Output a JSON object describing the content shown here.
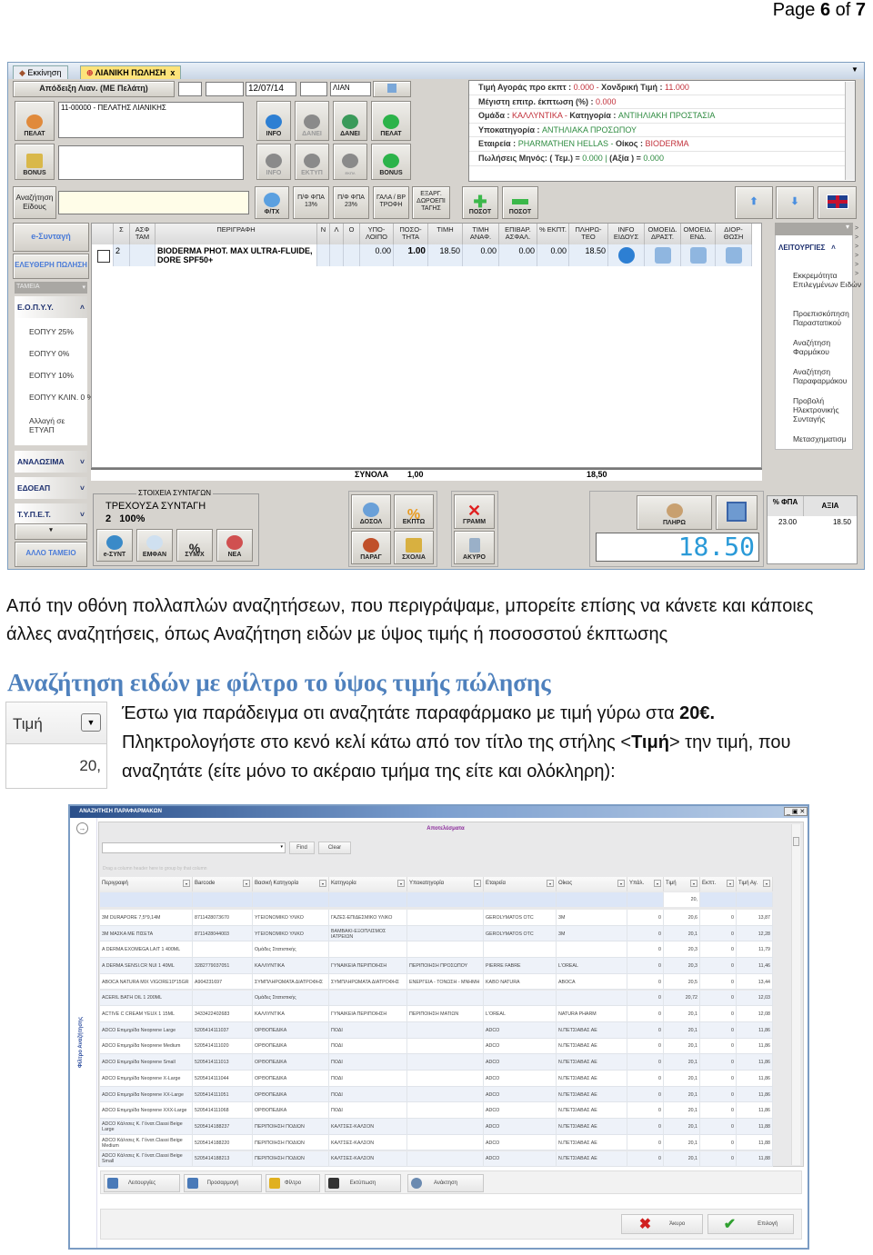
{
  "page_number": {
    "prefix": "Page ",
    "current": "6",
    "sep": " of ",
    "total": "7"
  },
  "pos_window": {
    "tabs": [
      {
        "label": "Εκκίνηση"
      },
      {
        "label": "ΛΙΑΝΙΚΗ ΠΩΛΗΣΗ",
        "close": "x"
      }
    ],
    "doc_type_button": "Απόδειξη Λιαν. (ΜΕ Πελάτη)",
    "date": "12/07/14",
    "series": "ΛΙΑΝ",
    "customer": "11-00000 - ΠΕΛΑΤΗΣ ΛΙΑΝΙΚΗΣ",
    "row1_buttons": [
      "ΠΕΛΑΤ",
      "INFO",
      "ΔΑΝΕΙ",
      "ΔΑΝΕΙ",
      "ΠΕΛΑΤ"
    ],
    "row2_buttons": [
      "BONUS",
      "INFO",
      "ΕΚΤΥΠ",
      "ΕΚΠΛ",
      "BONUS"
    ],
    "search_button": "Αναζήτηση Είδους",
    "row3_buttons": [
      "Φ/ΤΧ",
      "Π/Φ ΦΠΑ 13%",
      "Π/Φ ΦΠΑ 23%",
      "ΓΑΛΑ / ΒΡ ΤΡΟΦΗ",
      "ΕΞΑΡΓ. ΔΩΡΟΕΠΙ ΤΑΓΗΣ",
      "ΠΟΣΟΤ",
      "ΠΟΣΟΤ"
    ],
    "info": {
      "l1a": "Τιμή Αγοράς προ εκπτ : ",
      "v1a": "0.000 - ",
      "l1b": "Χονδρική Τιμή : ",
      "v1b": "11.000",
      "l2": "Μέγιστη επιτρ. έκπτωση (%) : ",
      "v2": "0.000",
      "l3a": "Ομάδα : ",
      "v3a": "ΚΑΛΛΥΝΤΙΚΑ - ",
      "l3b": "Κατηγορία : ",
      "v3b": "ΑΝΤΙΗΛΙΑΚΗ ΠΡΟΣΤΑΣΙΑ",
      "l4": "Υποκατηγορία : ",
      "v4": "ΑΝΤΗΛΙΑΚΑ ΠΡΟΣΩΠΟΥ",
      "l5a": "Εταιρεία : ",
      "v5a": "PHARMATHEN HELLAS - ",
      "l5b": "Οίκος : ",
      "v5b": "BIODERMA",
      "l6a": "Πωλήσεις Μηνός: ( Τεμ.) = ",
      "v6a": "0.000 | ",
      "l6b": "(Αξία ) = ",
      "v6b": "0.000"
    },
    "grid_headers": [
      "",
      "Σ",
      "ΑΣΦ ΤΑΜ",
      "ΠΕΡΙΓΡΑΦΗ",
      "Ν",
      "Λ",
      "Ο",
      "ΥΠΟ-ΛΟΙΠΟ",
      "ΠΟΣΟ-ΤΗΤΑ",
      "ΤΙΜΗ",
      "ΤΙΜΗ ΑΝΑΦ.",
      "ΕΠΙΒΑΡ. ΑΣΦΑΛ.",
      "% ΕΚΠΤ.",
      "ΠΛΗΡΩ-ΤΕΟ",
      "INFO ΕΙΔΟΥΣ",
      "ΟΜΟΕΙΔ. ΔΡΑΣΤ.",
      "ΟΜΟΕΙΔ. ΕΝΔ.",
      "ΔΙΟΡ-ΘΩΣΗ"
    ],
    "grid_row": {
      "s": "2",
      "desc": "BIODERMA PHOT. MAX ULTRA-FLUIDE, DORE SPF50+",
      "remaining": "0.00",
      "qty": "1.00",
      "price": "18.50",
      "ref_price": "0.00",
      "surcharge": "0.00",
      "discount": "0.00",
      "payable": "18.50"
    },
    "totals": {
      "label": "ΣΥΝΟΛΑ",
      "qty": "1,00",
      "amount": "18,50"
    },
    "sidebar": {
      "esyntagi": "e-Συνταγή",
      "free_sale": "ΕΛΕΥΘΕΡΗ ΠΩΛΗΣΗ",
      "funds": "ΤΑΜΕΙΑ",
      "eopyy": "Ε.Ο.Π.Υ.Υ.",
      "eopyy_items": [
        "ΕΟΠΥΥ 25%",
        "ΕΟΠΥΥ  0%",
        "ΕΟΠΥΥ  10%",
        "ΕΟΠΥΥ ΚΛΙΝ. 0 %",
        "Αλλαγή σε ΕΤΥΑΠ"
      ],
      "groups": [
        "ΑΝΑΛΩΣΙΜΑ",
        "ΕΔΟΕΑΠ",
        "Τ.Υ.Π.Ε.Τ."
      ],
      "other_fund": "ΑΛΛΟ ΤΑΜΕΙΟ"
    },
    "functions": {
      "title": "ΛΕΙΤΟΥΡΓΙΕΣ",
      "items": [
        "Εκκρεμότητα Επιλεγμένων Ειδών",
        "Προεπισκόπηση Παραστατικού",
        "Αναζήτηση Φαρμάκου",
        "Αναζήτηση Παραφαρμάκου",
        "Προβολή Ηλεκτρονικής Συνταγής",
        "Μετασχηματισμ"
      ]
    },
    "prescription": {
      "legend": "ΣΤΟΙΧΕΙΑ ΣΥΝΤΑΓΩΝ",
      "current": "ΤΡΕΧΟΥΣΑ ΣΥΝΤΑΓΗ",
      "value": "2   100%",
      "buttons": [
        "e-ΣΥΝΤ",
        "ΕΜΦΑΝ",
        "ΣΥΜ/Χ",
        "ΝΕΑ"
      ]
    },
    "action_buttons": [
      "ΔΟΣΟΛ",
      "ΕΚΠΤΩ",
      "ΠΑΡΑΓ",
      "ΣΧΟΛΙΑ",
      "ΓΡΑΜΜ",
      "ΑΚΥΡΟ"
    ],
    "pay_button": "ΠΛΗΡΩ",
    "total_display": "18.50",
    "vat": {
      "h1": "% ΦΠΑ",
      "h2": "ΑΞΙΑ",
      "rate": "23.00",
      "value": "18.50"
    }
  },
  "intro_text": [
    "Από την οθόνη πολλαπλών αναζητήσεων, που περιγράψαμε, μπορείτε επίσης να κάνετε και κάποιες",
    "άλλες αναζητήσεις, όπως Αναζήτηση ειδών με ύψος τιμής ή ποσοσστού έκπτωσης"
  ],
  "section_title": "Αναζήτηση ειδών με φίλτρο το ύψος τιμής πώλησης",
  "thumb": {
    "header": "Τιμή",
    "value": "20,"
  },
  "body": {
    "l1": "Έστω για παράδειγμα οτι αναζητάτε παραφάρμακο με τιμή γύρω στα ",
    "l1b": "20€.",
    "l2a": "Πληκτρολογήστε στο κενό κελί κάτω από τον τίτλο της στήλης <",
    "l2b": "Τιμή",
    "l2c": "> την τιμή, που",
    "l3": "αναζητάτε (είτε μόνο το ακέραιο τμήμα της είτε και ολόκληρη):"
  },
  "search_window": {
    "title": "ΑΝΑΖΗΤΗΣΗ ΠΑΡΑΦΑΡΜΑΚΩΝ",
    "results": "Αποτελέσματα",
    "find": "Find",
    "clear": "Clear",
    "group_hint": "Drag a column header here to group by that column",
    "side_label": "Φίλτρο Αναζήτησης",
    "columns": [
      "Περιγραφή",
      "Barcode",
      "Βασική Κατηγορία",
      "Κατηγορία",
      "Υποκατηγορία",
      "Εταιρεία",
      "Οίκος",
      "Υπάλ.",
      "Τιμή",
      "Εκπτ.",
      "Τιμή Αγ."
    ],
    "price_filter": "20,",
    "rows": [
      [
        "3M DURAPORE 7,5*9,14M",
        "8711428073670",
        "ΥΓΕΙΟΝΟΜΙΚΟ ΥΛΙΚΟ",
        "ΓΑΖΕΣ-ΕΠΙΔΕΣΜΙΚΟ ΥΛΙΚΟ",
        "",
        "GEROLYMATOS OTC",
        "3M",
        "0",
        "20,6",
        "0",
        "13,87"
      ],
      [
        "3M ΜΑΣΚΑ ΜΕ ΠΙΣΕΤΑ",
        "8711428044003",
        "ΥΓΕΙΟΝΟΜΙΚΟ ΥΛΙΚΟ",
        "ΒΑΜΒΑΚΙ-ΕΞΟΠΛΙΣΜΟΣ ΙΑΤΡΕΙΩΝ",
        "",
        "GEROLYMATOS OTC",
        "3M",
        "0",
        "20,1",
        "0",
        "12,28"
      ],
      [
        "A DERMA EXOMEGA LAIT 1 400ML",
        "",
        "Ομάδες Στατιστικής",
        "",
        "",
        "",
        "",
        "0",
        "20,3",
        "0",
        "11,79"
      ],
      [
        "A DERMA SENSI.CR NUI 1 40ML",
        "3282779037051",
        "ΚΑΛΛΥΝΤΙΚΑ",
        "ΓΥΝΑΙΚΕΙΑ ΠΕΡΙΠΟΙΗΣΗ",
        "ΠΕΡΙΠΟΙΗΣΗ ΠΡΟΣΩΠΟΥ",
        "PIERRE FABRE",
        "L'OREAL",
        "0",
        "20,3",
        "0",
        "11,46"
      ],
      [
        "ABOCA NATURA MIX VIGORE10*15GR",
        "A904231697",
        "ΣΥΜΠΛΗΡΩΜΑΤΑ ΔΙΑΤΡΟΦΗΣ",
        "ΣΥΜΠΛΗΡΩΜΑΤΑ ΔΙΑΤΡΟΦΗΣ",
        "ΕΝΕΡΓΕΙΑ - ΤΟΝΩΣΗ - ΜΝΗΜΗ",
        "KABO NATURA",
        "ABOCA",
        "0",
        "20,5",
        "0",
        "13,44"
      ],
      [
        "ACERIL BATH OIL 1 200ML",
        "",
        "Ομάδες Στατιστικής",
        "",
        "",
        "",
        "",
        "0",
        "20,72",
        "0",
        "12,03"
      ],
      [
        "ACTIVE C CREAM YEUX 1 15ML",
        "3433422402683",
        "ΚΑΛΛΥΝΤΙΚΑ",
        "ΓΥΝΑΙΚΕΙΑ ΠΕΡΙΠΟΙΗΣΗ",
        "ΠΕΡΙΠΟΙΗΣΗ ΜΑΤΙΩΝ",
        "L'OREAL",
        "NATURA PHARM",
        "0",
        "20,1",
        "0",
        "12,08"
      ],
      [
        "ADCO Επιμηρίδα Neoprene Large",
        "5205414111037",
        "ΟΡΘΟΠΕΔΙΚΑ",
        "ΠΟΔΙ",
        "",
        "ADCO",
        "Ν.ΠΕΤΣΙΑΒΑΣ ΑΕ",
        "0",
        "20,1",
        "0",
        "11,86"
      ],
      [
        "ADCO Επιμηρίδα Neoprene Medium",
        "5205414111020",
        "ΟΡΘΟΠΕΔΙΚΑ",
        "ΠΟΔΙ",
        "",
        "ADCO",
        "Ν.ΠΕΤΣΙΑΒΑΣ ΑΕ",
        "0",
        "20,1",
        "0",
        "11,86"
      ],
      [
        "ADCO Επιμηρίδα Neoprene Small",
        "5205414111013",
        "ΟΡΘΟΠΕΔΙΚΑ",
        "ΠΟΔΙ",
        "",
        "ADCO",
        "Ν.ΠΕΤΣΙΑΒΑΣ ΑΕ",
        "0",
        "20,1",
        "0",
        "11,86"
      ],
      [
        "ADCO Επιμηρίδα Neoprene X-Large",
        "5205414111044",
        "ΟΡΘΟΠΕΔΙΚΑ",
        "ΠΟΔΙ",
        "",
        "ADCO",
        "Ν.ΠΕΤΣΙΑΒΑΣ ΑΕ",
        "0",
        "20,1",
        "0",
        "11,86"
      ],
      [
        "ADCO Επιμηρίδα Neoprene XX-Large",
        "5205414111051",
        "ΟΡΘΟΠΕΔΙΚΑ",
        "ΠΟΔΙ",
        "",
        "ADCO",
        "Ν.ΠΕΤΣΙΑΒΑΣ ΑΕ",
        "0",
        "20,1",
        "0",
        "11,86"
      ],
      [
        "ADCO Επιμηρίδα Neoprene XXX-Large",
        "5205414111068",
        "ΟΡΘΟΠΕΔΙΚΑ",
        "ΠΟΔΙ",
        "",
        "ADCO",
        "Ν.ΠΕΤΣΙΑΒΑΣ ΑΕ",
        "0",
        "20,1",
        "0",
        "11,86"
      ],
      [
        "ADCO Κάλτσες Κ. Γόνατ.Classi Beige Large",
        "5205414188237",
        "ΠΕΡΙΠΟΙΗΣΗ ΠΟΔΙΩΝ",
        "ΚΑΛΤΣΕΣ-ΚΑΛΣΟΝ",
        "",
        "ADCO",
        "Ν.ΠΕΤΣΙΑΒΑΣ ΑΕ",
        "0",
        "20,1",
        "0",
        "11,88"
      ],
      [
        "ADCO Κάλτσες Κ. Γόνατ.Classi Beige Medium",
        "5205414188220",
        "ΠΕΡΙΠΟΙΗΣΗ ΠΟΔΙΩΝ",
        "ΚΑΛΤΣΕΣ-ΚΑΛΣΟΝ",
        "",
        "ADCO",
        "Ν.ΠΕΤΣΙΑΒΑΣ ΑΕ",
        "0",
        "20,1",
        "0",
        "11,88"
      ],
      [
        "ADCO Κάλτσες Κ. Γόνατ.Classi Beige Small",
        "5205414188213",
        "ΠΕΡΙΠΟΙΗΣΗ ΠΟΔΙΩΝ",
        "ΚΑΛΤΣΕΣ-ΚΑΛΣΟΝ",
        "",
        "ADCO",
        "Ν.ΠΕΤΣΙΑΒΑΣ ΑΕ",
        "0",
        "20,1",
        "0",
        "11,88"
      ]
    ],
    "toolbar": [
      "Λειτουργίες",
      "Προσαρμογή",
      "Φίλτρο",
      "Εκτύπωση",
      "Ανάκτηση"
    ],
    "cancel": "Άκυρο",
    "select": "Επιλογή"
  },
  "colors": {
    "heading": "#4f81bd",
    "red_value": "#c2303a",
    "green_value": "#2e8b40",
    "window_border": "#7b9cc4"
  }
}
